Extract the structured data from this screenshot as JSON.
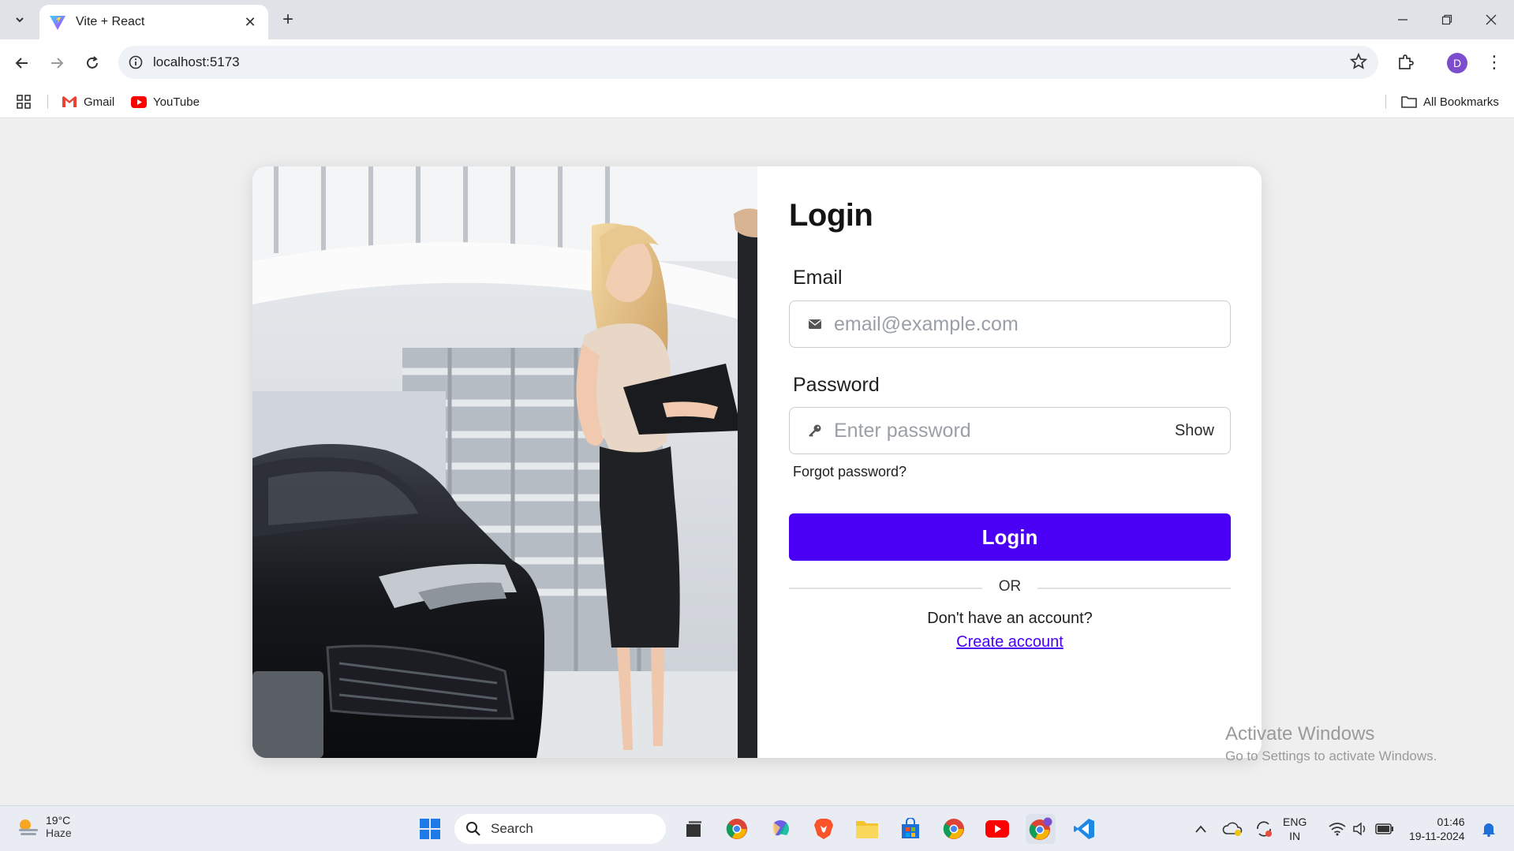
{
  "browser": {
    "tab_title": "Vite + React",
    "url": "localhost:5173",
    "profile_initial": "D",
    "bookmarks": [
      {
        "label": "Gmail",
        "icon": "gmail-icon"
      },
      {
        "label": "YouTube",
        "icon": "youtube-icon"
      }
    ],
    "all_bookmarks_label": "All Bookmarks"
  },
  "login": {
    "title": "Login",
    "email_label": "Email",
    "email_placeholder": "email@example.com",
    "password_label": "Password",
    "password_placeholder": "Enter password",
    "show_label": "Show",
    "forgot_label": "Forgot password?",
    "submit_label": "Login",
    "or_label": "OR",
    "no_account_text": "Don't have an account?",
    "create_account_label": "Create account",
    "accent_color": "#4a00f5"
  },
  "watermark": {
    "line1": "Activate Windows",
    "line2": "Go to Settings to activate Windows."
  },
  "taskbar": {
    "temperature": "19°C",
    "condition": "Haze",
    "search_placeholder": "Search",
    "language": "ENG",
    "region": "IN",
    "time": "01:46",
    "date": "19-11-2024"
  }
}
